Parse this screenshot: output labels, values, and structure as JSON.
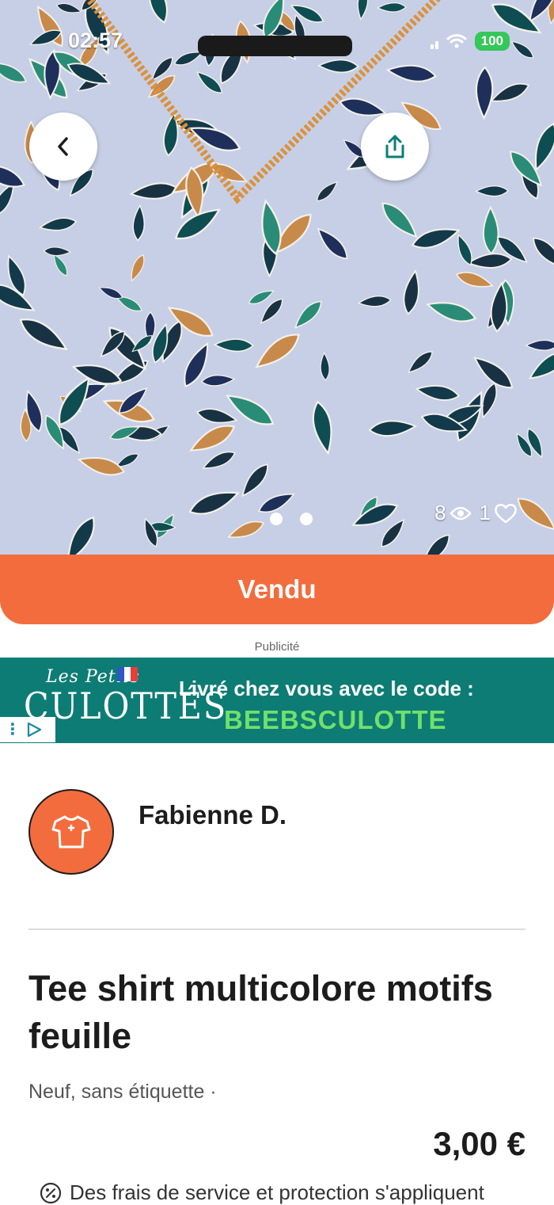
{
  "status_bar": {
    "time": "02:57",
    "battery": "100"
  },
  "photo": {
    "views": "8",
    "likes": "1",
    "page_count": 2,
    "current_page": 1
  },
  "sold_label": "Vendu",
  "ad": {
    "label": "Publicité",
    "brand_top": "Les Petits",
    "brand_main": "CULOTTÉS",
    "line1": "Livré chez vous avec le code :",
    "code": "BEEBSCULOTTE"
  },
  "seller": {
    "name": "Fabienne D."
  },
  "item": {
    "title": "Tee shirt multicolore motifs feuille",
    "condition": "Neuf, sans étiquette ·",
    "price": "3,00 €",
    "fees_note": "Des frais de service et protection s'appliquent"
  },
  "colors": {
    "accent": "#f36c3d",
    "ad_bg": "#0d7c74",
    "ad_code": "#6fe06b"
  }
}
